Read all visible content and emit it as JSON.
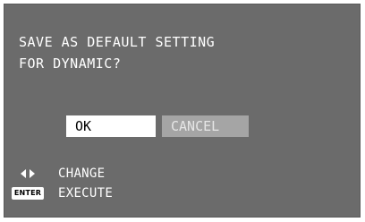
{
  "dialog": {
    "message_line1": "SAVE AS DEFAULT SETTING",
    "message_line2": "FOR DYNAMIC?",
    "ok_label": "OK",
    "cancel_label": "CANCEL"
  },
  "legend": {
    "change_icon": "left-right-arrows-icon",
    "change_label": "CHANGE",
    "execute_icon": "enter-key-icon",
    "execute_key": "ENTER",
    "execute_label": "EXECUTE"
  },
  "colors": {
    "background": "#6b6b6b",
    "text": "#ffffff",
    "selected_button_bg": "#ffffff",
    "selected_button_text": "#000000",
    "unselected_button_bg": "#a5a5a5",
    "unselected_button_text": "#e6e6e6"
  }
}
